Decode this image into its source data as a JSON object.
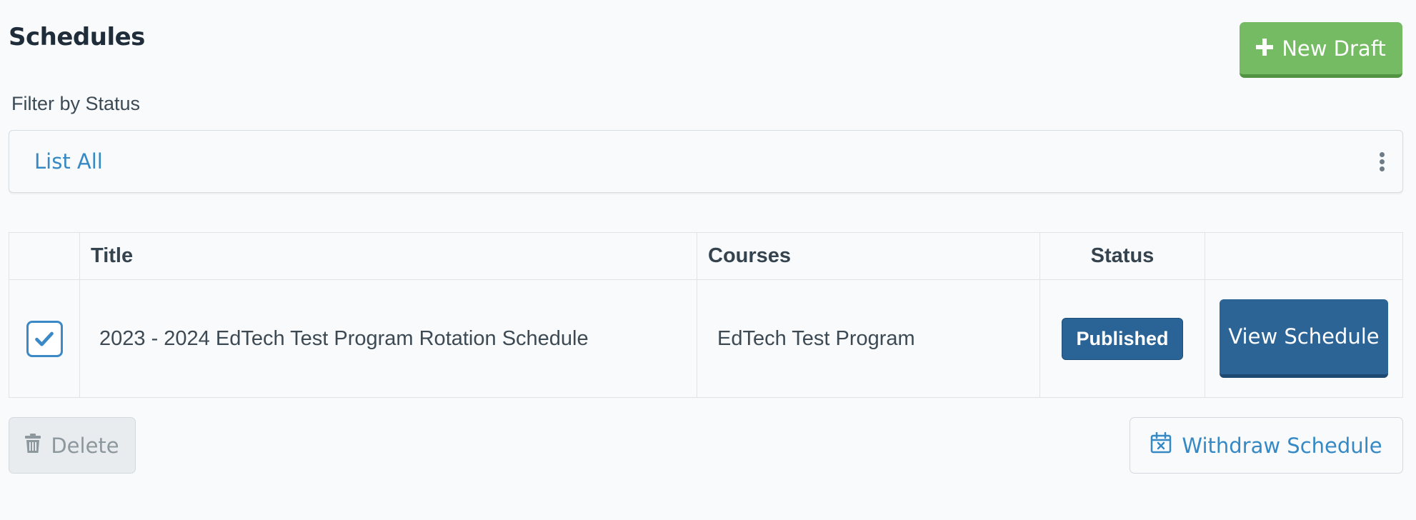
{
  "header": {
    "title": "Schedules",
    "new_draft_label": "New Draft"
  },
  "filter": {
    "label": "Filter by Status",
    "selected": "List All"
  },
  "table": {
    "columns": [
      "",
      "Title",
      "Courses",
      "Status",
      ""
    ],
    "rows": [
      {
        "checked": true,
        "title": "2023 - 2024 EdTech Test Program Rotation Schedule",
        "courses": "EdTech Test Program",
        "status": "Published",
        "action_label": "View Schedule"
      }
    ]
  },
  "footer": {
    "delete_label": "Delete",
    "withdraw_label": "Withdraw Schedule"
  },
  "icons": {
    "new_draft": "plus-icon",
    "filter_menu": "kebab-icon",
    "row_checkbox": "check-icon",
    "delete": "trash-icon",
    "withdraw": "calendar-x-icon"
  },
  "colors": {
    "accent_green": "#74bb64",
    "primary_blue": "#2c6496",
    "link_blue": "#3589c4",
    "disabled_gray": "#8d979e"
  }
}
